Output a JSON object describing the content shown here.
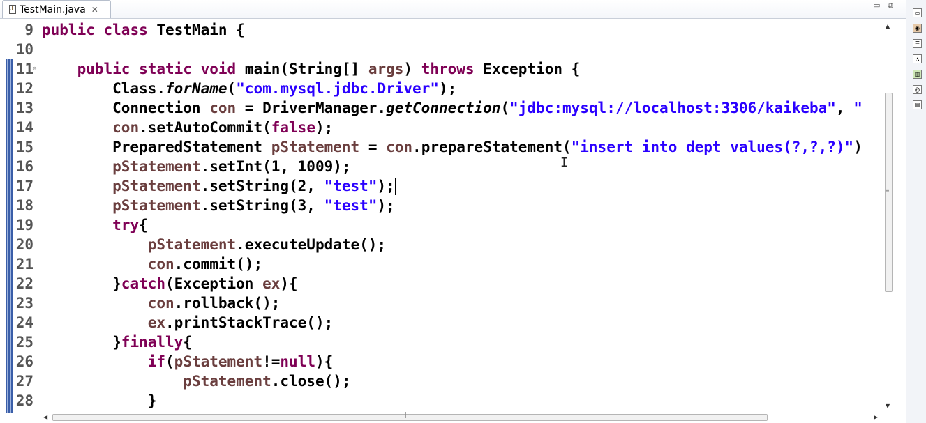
{
  "tab": {
    "title": "TestMain.java",
    "close_glyph": "✕"
  },
  "window_buttons": {
    "minimize": "▭",
    "maximize": "⧉"
  },
  "code_lines": [
    {
      "num": "9",
      "segments": [
        [
          "kw",
          "public "
        ],
        [
          "kw",
          "class "
        ],
        [
          "",
          "TestMain {"
        ]
      ]
    },
    {
      "num": "10",
      "segments": []
    },
    {
      "num": "11",
      "fold": true,
      "segments": [
        [
          "",
          "    "
        ],
        [
          "kw",
          "public "
        ],
        [
          "kw",
          "static "
        ],
        [
          "kw",
          "void "
        ],
        [
          "",
          "main(String[] "
        ],
        [
          "var",
          "args"
        ],
        [
          "",
          " ) "
        ],
        [
          "kw",
          "throws "
        ],
        [
          "",
          "Exception {"
        ]
      ]
    },
    {
      "num": "12",
      "segments": [
        [
          "",
          "        Class."
        ],
        [
          "it",
          "forName"
        ],
        [
          "",
          "("
        ],
        [
          "str",
          "\"com.mysql.jdbc.Driver\""
        ],
        [
          "",
          ");"
        ]
      ]
    },
    {
      "num": "13",
      "segments": [
        [
          "",
          "        Connection "
        ],
        [
          "var",
          "con"
        ],
        [
          "",
          " = DriverManager."
        ],
        [
          "it",
          "getConnection"
        ],
        [
          "",
          "("
        ],
        [
          "str",
          "\"jdbc:mysql://localhost:3306/kaikeba\""
        ],
        [
          "",
          ", "
        ],
        [
          "str",
          "\""
        ]
      ]
    },
    {
      "num": "14",
      "segments": [
        [
          "",
          "        "
        ],
        [
          "var",
          "con"
        ],
        [
          "",
          ".setAutoCommit("
        ],
        [
          "kw",
          "false"
        ],
        [
          "",
          ");"
        ]
      ]
    },
    {
      "num": "15",
      "segments": [
        [
          "",
          "        PreparedStatement "
        ],
        [
          "var",
          "pStatement"
        ],
        [
          "",
          " = "
        ],
        [
          "var",
          "con"
        ],
        [
          "",
          ".prepareStatement("
        ],
        [
          "str",
          "\"insert into dept values(?,?,?)\""
        ],
        [
          "",
          ")"
        ]
      ]
    },
    {
      "num": "16",
      "segments": [
        [
          "",
          "        "
        ],
        [
          "var",
          "pStatement"
        ],
        [
          "",
          ".setInt(1, 1009);"
        ]
      ]
    },
    {
      "num": "17",
      "caret": true,
      "segments": [
        [
          "",
          "        "
        ],
        [
          "var",
          "pStatement"
        ],
        [
          "",
          ".setString(2, "
        ],
        [
          "str",
          "\"test\""
        ],
        [
          "",
          ");"
        ]
      ]
    },
    {
      "num": "18",
      "segments": [
        [
          "",
          "        "
        ],
        [
          "var",
          "pStatement"
        ],
        [
          "",
          ".setString(3, "
        ],
        [
          "str",
          "\"test\""
        ],
        [
          "",
          ");"
        ]
      ]
    },
    {
      "num": "19",
      "segments": [
        [
          "",
          "        "
        ],
        [
          "kw",
          "try"
        ],
        [
          "",
          "{"
        ]
      ]
    },
    {
      "num": "20",
      "segments": [
        [
          "",
          "            "
        ],
        [
          "var",
          "pStatement"
        ],
        [
          "",
          ".executeUpdate();"
        ]
      ]
    },
    {
      "num": "21",
      "segments": [
        [
          "",
          "            "
        ],
        [
          "var",
          "con"
        ],
        [
          "",
          ".commit();"
        ]
      ]
    },
    {
      "num": "22",
      "segments": [
        [
          "",
          "        }"
        ],
        [
          "kw",
          "catch"
        ],
        [
          "",
          "(Exception "
        ],
        [
          "var",
          "ex"
        ],
        [
          "",
          "){"
        ]
      ]
    },
    {
      "num": "23",
      "segments": [
        [
          "",
          "            "
        ],
        [
          "var",
          "con"
        ],
        [
          "",
          ".rollback();"
        ]
      ]
    },
    {
      "num": "24",
      "segments": [
        [
          "",
          "            "
        ],
        [
          "var",
          "ex"
        ],
        [
          "",
          ".printStackTrace();"
        ]
      ]
    },
    {
      "num": "25",
      "segments": [
        [
          "",
          "        }"
        ],
        [
          "kw",
          "finally"
        ],
        [
          "",
          "{"
        ]
      ]
    },
    {
      "num": "26",
      "segments": [
        [
          "",
          "            "
        ],
        [
          "kw",
          "if"
        ],
        [
          "",
          "("
        ],
        [
          "var",
          "pStatement"
        ],
        [
          "",
          "!="
        ],
        [
          "kw",
          "null"
        ],
        [
          "",
          "){"
        ]
      ]
    },
    {
      "num": "27",
      "segments": [
        [
          "",
          "                "
        ],
        [
          "var",
          "pStatement"
        ],
        [
          "",
          ".close();"
        ]
      ]
    },
    {
      "num": "28",
      "segments": [
        [
          "",
          "            }"
        ]
      ]
    }
  ],
  "right_toolbar_icons": [
    "restore-view-icon",
    "task-list-icon",
    "outline-icon",
    "type-hierarchy-icon",
    "package-explorer-icon",
    "javadoc-icon",
    "console-icon"
  ],
  "colors": {
    "keyword": "#7f0055",
    "string": "#2a00ff",
    "local_variable": "#6a3e3e",
    "default": "#000000"
  }
}
